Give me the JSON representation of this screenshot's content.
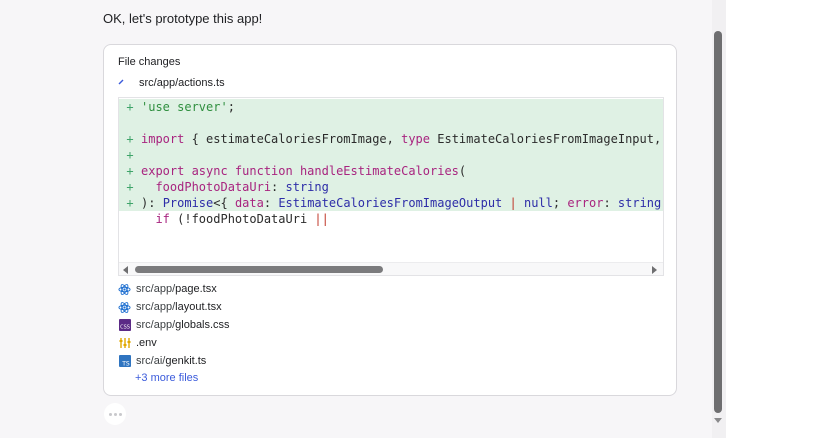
{
  "chat": {
    "message": "OK, let's prototype this app!"
  },
  "file_changes": {
    "title": "File changes",
    "active_file": "src/app/actions.ts",
    "code_lines": [
      {
        "marker": "+",
        "text": "'use server';"
      },
      {
        "marker": "",
        "text": ""
      },
      {
        "marker": "+",
        "text": "import { estimateCaloriesFromImage, type EstimateCaloriesFromImageInput, typ"
      },
      {
        "marker": "+",
        "text": ""
      },
      {
        "marker": "+",
        "text": "export async function handleEstimateCalories("
      },
      {
        "marker": "+",
        "text": "  foodPhotoDataUri: string"
      },
      {
        "marker": "+",
        "text": "): Promise<{ data: EstimateCaloriesFromImageOutput | null; error: string | n"
      },
      {
        "marker": "",
        "text": "  if (!foodPhotoDataUri ||"
      }
    ],
    "files": [
      {
        "dir": "src/app/",
        "name": "page.tsx",
        "icon": "react-icon"
      },
      {
        "dir": "src/app/",
        "name": "layout.tsx",
        "icon": "react-icon"
      },
      {
        "dir": "src/app/",
        "name": "globals.css",
        "icon": "css-file-icon"
      },
      {
        "dir": "",
        "name": ".env",
        "icon": "env-file-icon"
      },
      {
        "dir": "src/ai/",
        "name": "genkit.ts",
        "icon": "typescript-file-icon"
      }
    ],
    "more_files": "+3 more files"
  },
  "colors": {
    "added_line_bg": "#dff1e4",
    "link": "#3b5bdb",
    "keyword": "#a8247f"
  }
}
